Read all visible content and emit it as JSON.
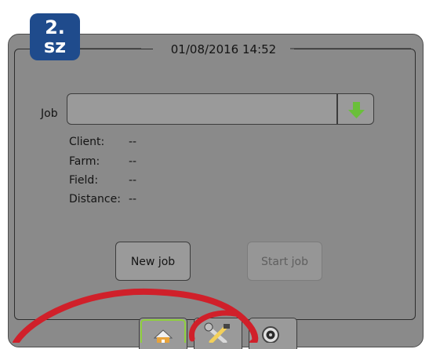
{
  "badge": {
    "line1": "2.",
    "line2": "sz"
  },
  "header": {
    "datetime": "01/08/2016 14:52"
  },
  "job": {
    "label": "Job",
    "value": ""
  },
  "details": [
    {
      "key": "Client:",
      "value": "--"
    },
    {
      "key": "Farm:",
      "value": "--"
    },
    {
      "key": "Field:",
      "value": "--"
    },
    {
      "key": "Distance:",
      "value": "--"
    }
  ],
  "buttons": {
    "new_job": "New job",
    "start_job": "Start job"
  },
  "tabs": [
    {
      "name": "home",
      "icon": "home-icon",
      "active": false
    },
    {
      "name": "tools",
      "icon": "tools-icon",
      "active": true
    },
    {
      "name": "camera",
      "icon": "camera-icon",
      "active": false
    }
  ],
  "colors": {
    "badge": "#1f4b8c",
    "arrow": "#6abf3a",
    "highlight": "#d0202a",
    "home_outline": "#8ecf3c"
  }
}
